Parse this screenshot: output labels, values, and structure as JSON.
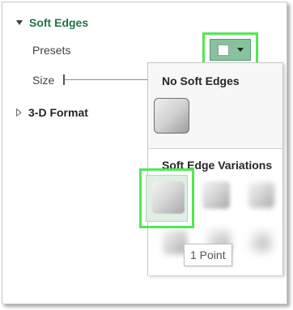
{
  "soft_edges": {
    "title": "Soft Edges",
    "presets_label": "Presets",
    "size_label": "Size",
    "size_value": 0
  },
  "three_d": {
    "title": "3-D Format"
  },
  "popup": {
    "heading_none": "No Soft Edges",
    "heading_variations": "Soft Edge Variations"
  },
  "tooltip": {
    "text": "1 Point"
  },
  "colors": {
    "accent_green": "#217346",
    "highlight_green": "#52e852",
    "button_green": "#86c29c"
  },
  "icons": {
    "expand": "triangle-down-icon",
    "collapse": "triangle-right-icon",
    "dropdown": "caret-down-icon"
  }
}
